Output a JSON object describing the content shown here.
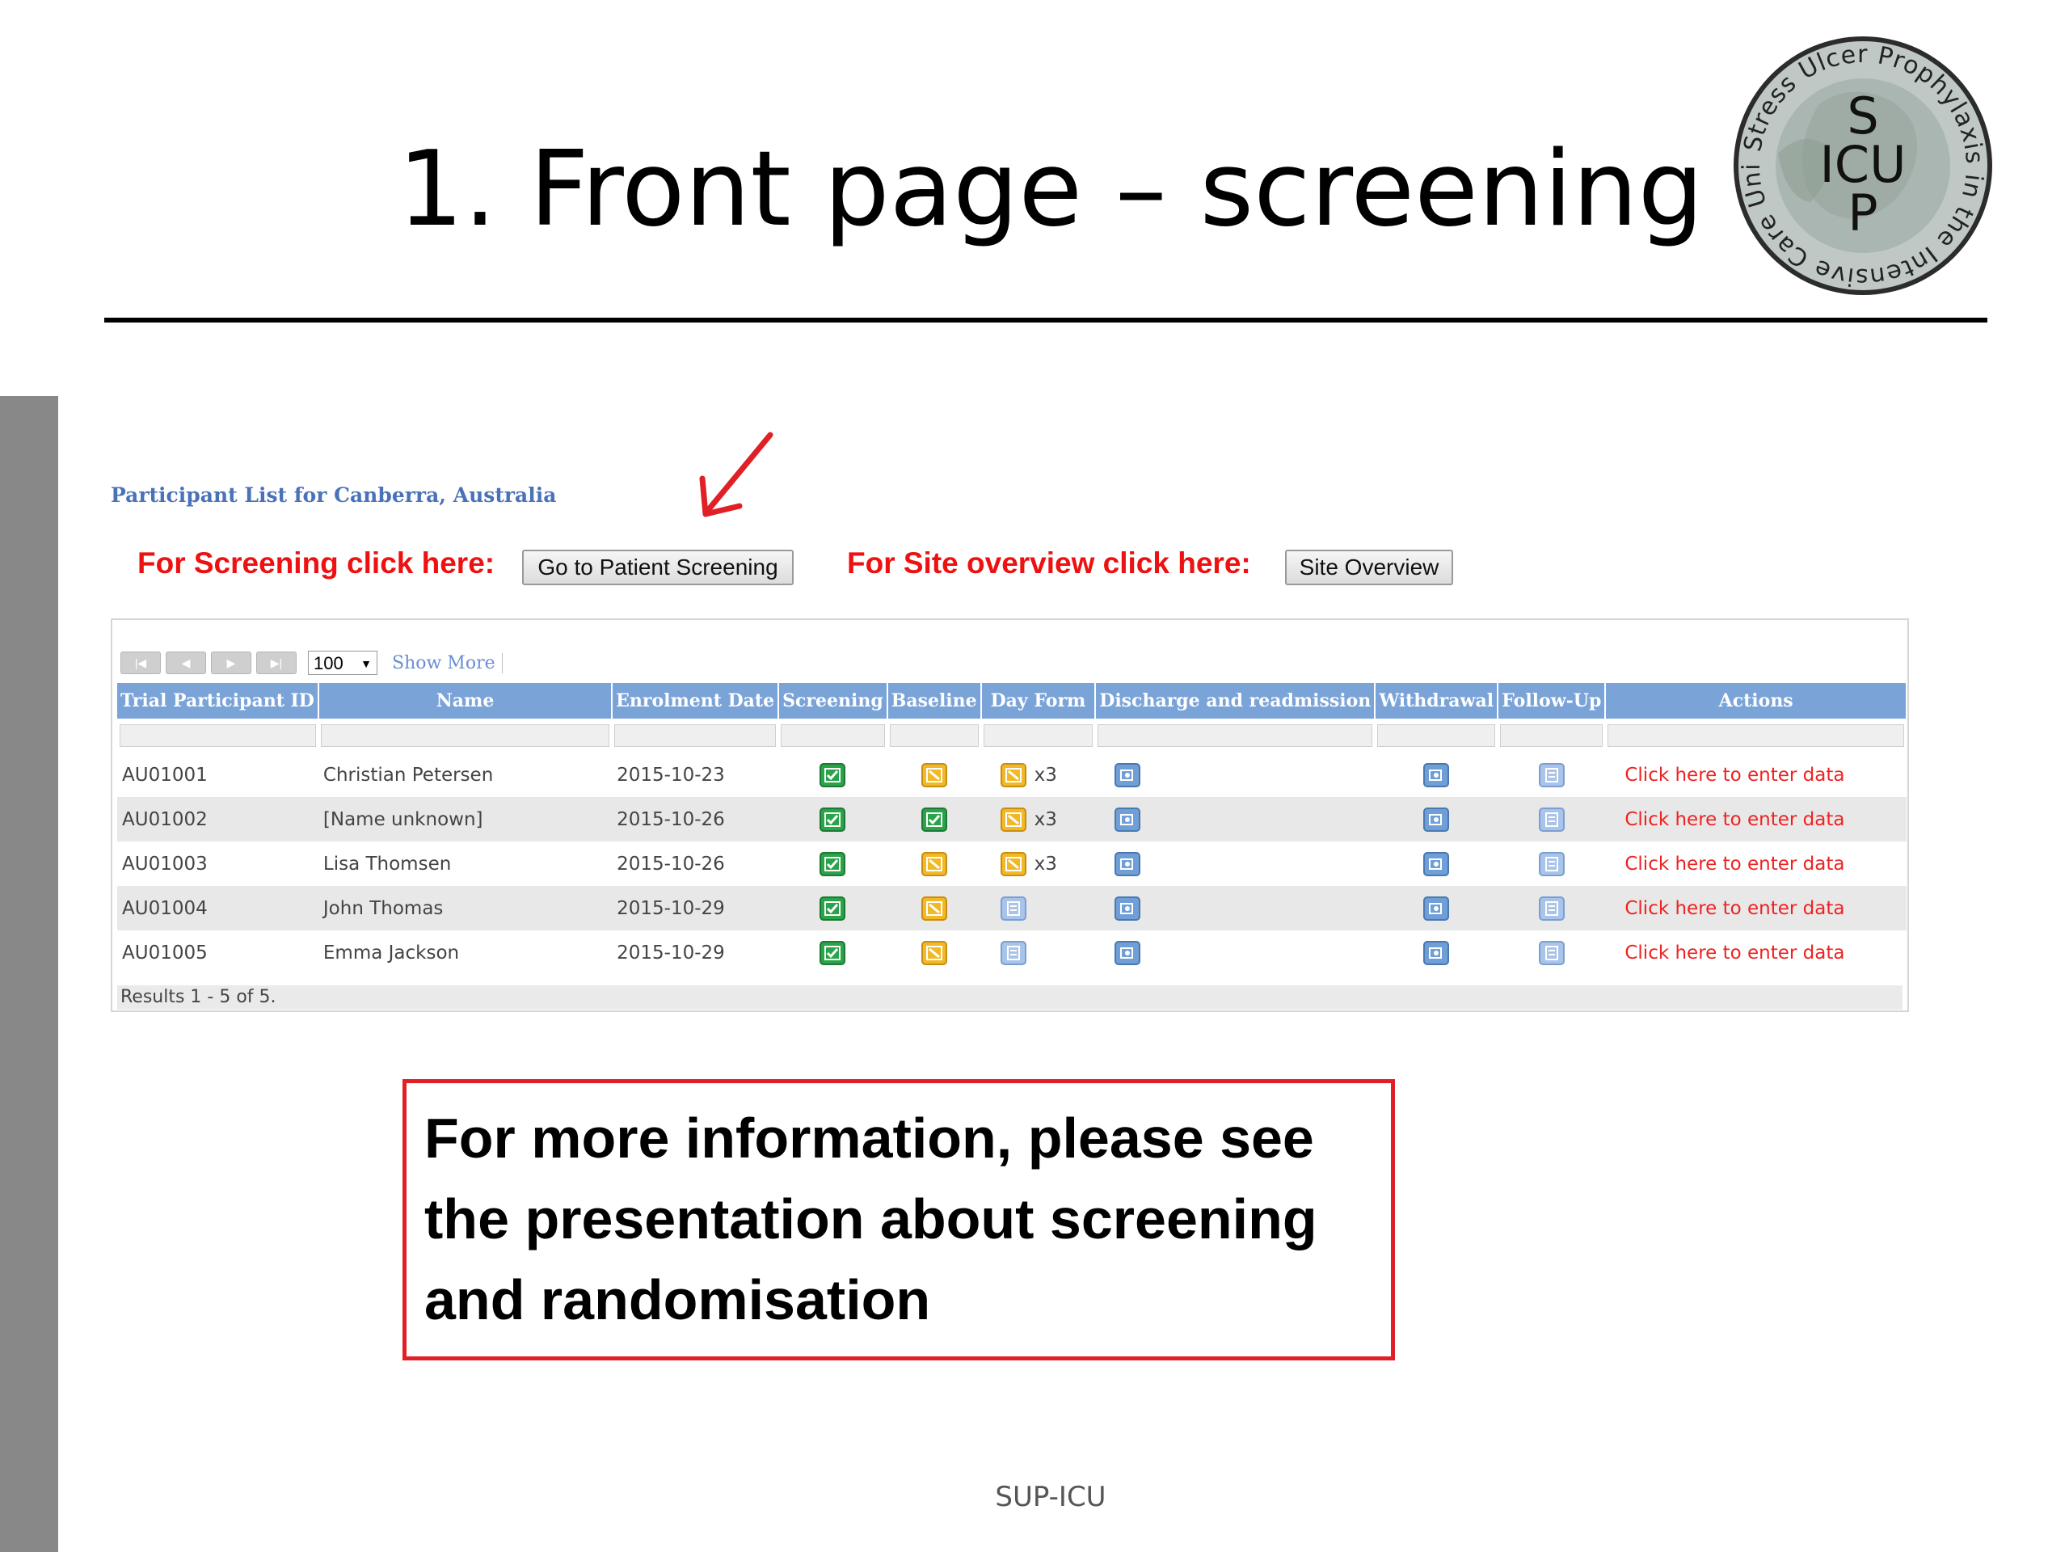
{
  "slide": {
    "title": "1. Front page – screening",
    "footer": "SUP-ICU"
  },
  "logo": {
    "ring_text": "Stress Ulcer Prophylaxis in the Intensive Care Unit",
    "center_lines": [
      "S",
      "ICU",
      "P"
    ]
  },
  "app": {
    "site_label": "Participant List for Canberra, Australia",
    "screening_prompt": "For Screening click here:",
    "screening_button": "Go to Patient Screening",
    "site_prompt": "For Site overview click here:",
    "site_button": "Site Overview",
    "pager": {
      "buttons": [
        "first-page-icon",
        "previous-page-icon",
        "next-page-icon",
        "last-page-icon"
      ],
      "page_size": "100",
      "show_more": "Show More"
    },
    "columns": [
      "Trial Participant ID",
      "Name",
      "Enrolment Date",
      "Screening",
      "Baseline",
      "Day Form",
      "Discharge and readmission",
      "Withdrawal",
      "Follow-Up",
      "Actions"
    ],
    "rows": [
      {
        "id": "AU01001",
        "name": "Christian Petersen",
        "date": "2015-10-23",
        "screening": "green",
        "baseline": "yellow",
        "dayform": "yellow",
        "dayform_count": "x3",
        "discharge": "blue",
        "withdrawal": "blue",
        "followup": "lblue",
        "action": "Click here to enter data"
      },
      {
        "id": "AU01002",
        "name": "[Name unknown]",
        "date": "2015-10-26",
        "screening": "green",
        "baseline": "green",
        "dayform": "yellow",
        "dayform_count": "x3",
        "discharge": "blue",
        "withdrawal": "blue",
        "followup": "lblue",
        "action": "Click here to enter data"
      },
      {
        "id": "AU01003",
        "name": "Lisa Thomsen",
        "date": "2015-10-26",
        "screening": "green",
        "baseline": "yellow",
        "dayform": "yellow",
        "dayform_count": "x3",
        "discharge": "blue",
        "withdrawal": "blue",
        "followup": "lblue",
        "action": "Click here to enter data"
      },
      {
        "id": "AU01004",
        "name": "John Thomas",
        "date": "2015-10-29",
        "screening": "green",
        "baseline": "yellow",
        "dayform": "lblue",
        "dayform_count": "",
        "discharge": "blue",
        "withdrawal": "blue",
        "followup": "lblue",
        "action": "Click here to enter data"
      },
      {
        "id": "AU01005",
        "name": "Emma Jackson",
        "date": "2015-10-29",
        "screening": "green",
        "baseline": "yellow",
        "dayform": "lblue",
        "dayform_count": "",
        "discharge": "blue",
        "withdrawal": "blue",
        "followup": "lblue",
        "action": "Click here to enter data"
      }
    ],
    "results": "Results 1 - 5 of 5."
  },
  "info_box": {
    "lines": [
      "For more information, please see",
      "the presentation about screening",
      "and randomisation"
    ]
  },
  "colors": {
    "header_blue": "#7aa3d8",
    "alert_red": "#ee1111",
    "status_green": "#2aa34a",
    "status_yellow": "#f1b928",
    "status_blue": "#6f9fd6"
  }
}
